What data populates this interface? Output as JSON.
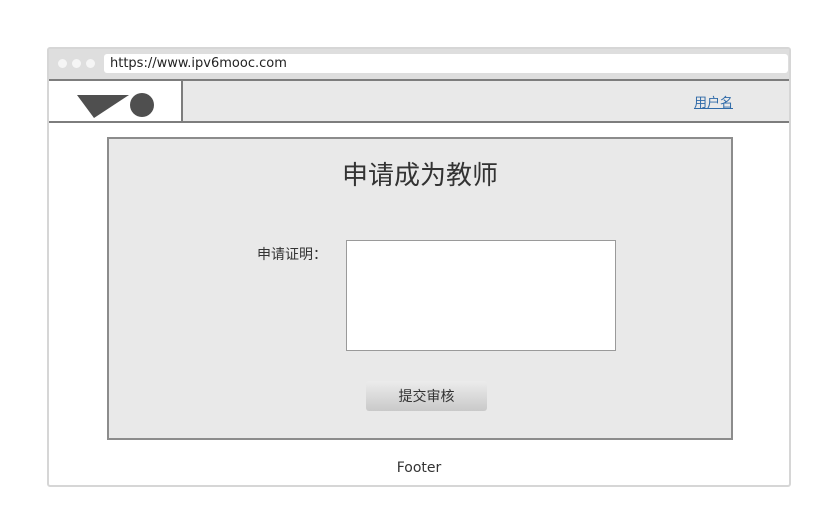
{
  "browser": {
    "url": "https://www.ipv6mooc.com"
  },
  "header": {
    "logo_icon": "logo-icon",
    "username_link": "用户名",
    "link_color": "#2f6aa8"
  },
  "form": {
    "title": "申请成为教师",
    "field_label": "申请证明：",
    "textarea_value": "",
    "submit_label": "提交审核"
  },
  "footer": {
    "text": "Footer"
  }
}
